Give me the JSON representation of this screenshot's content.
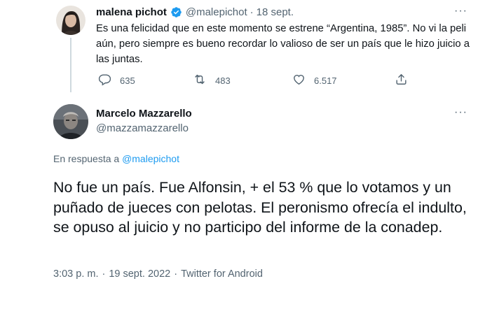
{
  "tweet1": {
    "author_name": "malena pichot",
    "author_handle": "@malepichot",
    "separator": "·",
    "date": "18 sept.",
    "text": "Es una felicidad que en este momento se estrene “Argentina, 1985”. No vi la peli aún, pero siempre es bueno recordar lo valioso de ser un país que le hizo juicio a las juntas.",
    "replies": "635",
    "retweets": "483",
    "likes": "6.517",
    "more": "···"
  },
  "tweet2": {
    "author_name": "Marcelo Mazzarello",
    "author_handle": "@mazzamazzarello",
    "reply_prefix": "En respuesta a",
    "reply_mention": "@malepichot",
    "text": "No fue un país. Fue Alfonsin, + el 53 % que lo votamos y un puñado de jueces con pelotas. El peronismo ofrecía el indulto, se opuso al juicio  y no participo del informe de la conadep.",
    "time": "3:03 p. m.",
    "separator": "·",
    "date": "19 sept. 2022",
    "source": "Twitter for Android",
    "more": "···"
  },
  "icons": [
    "verified-badge-icon",
    "reply-icon",
    "retweet-icon",
    "like-icon",
    "share-icon",
    "more-icon"
  ],
  "colors": {
    "accent": "#1d9bf0",
    "secondary_text": "#536471",
    "primary_text": "#0f1419",
    "thread_line": "#cfd9de"
  }
}
